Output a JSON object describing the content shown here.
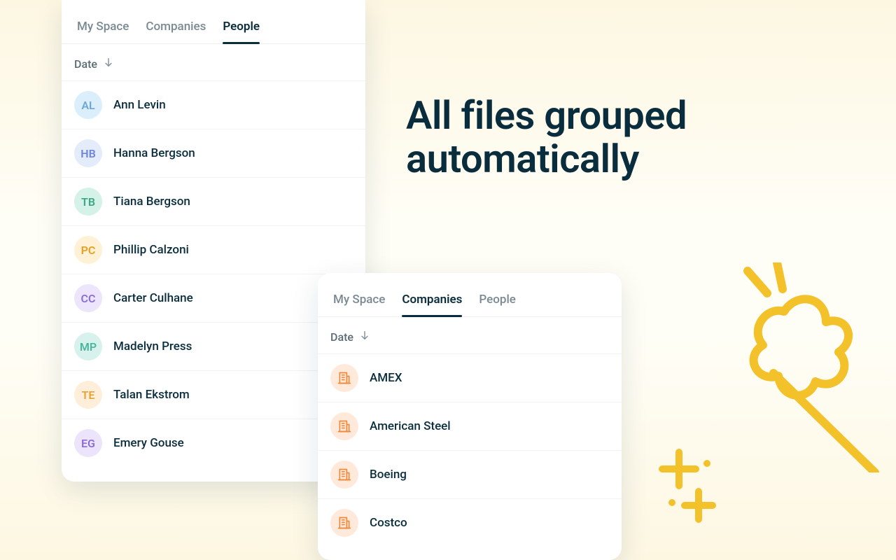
{
  "headline": "All files grouped automatically",
  "tabs": {
    "my_space": "My Space",
    "companies": "Companies",
    "people": "People"
  },
  "sort": {
    "label": "Date"
  },
  "people": [
    {
      "initials": "AL",
      "name": "Ann Levin",
      "bg": "#dbeefc",
      "fg": "#6ea7d6"
    },
    {
      "initials": "HB",
      "name": "Hanna Bergson",
      "bg": "#e4ebfb",
      "fg": "#6d86d9"
    },
    {
      "initials": "TB",
      "name": "Tiana Bergson",
      "bg": "#d4f2e8",
      "fg": "#3aa787"
    },
    {
      "initials": "PC",
      "name": "Phillip Calzoni",
      "bg": "#fff1d6",
      "fg": "#e9a021"
    },
    {
      "initials": "CC",
      "name": "Carter Culhane",
      "bg": "#ece5fb",
      "fg": "#8a6dd9"
    },
    {
      "initials": "MP",
      "name": "Madelyn Press",
      "bg": "#d7f2ec",
      "fg": "#4ab6a0"
    },
    {
      "initials": "TE",
      "name": "Talan Ekstrom",
      "bg": "#ffeeda",
      "fg": "#e7a231"
    },
    {
      "initials": "EG",
      "name": "Emery Gouse",
      "bg": "#ece4fb",
      "fg": "#8a6dd9"
    }
  ],
  "companies": [
    {
      "name": "AMEX"
    },
    {
      "name": "American Steel"
    },
    {
      "name": "Boeing"
    },
    {
      "name": "Costco"
    }
  ],
  "colors": {
    "accent": "#0a2d3e",
    "doodle": "#f3c22b"
  }
}
